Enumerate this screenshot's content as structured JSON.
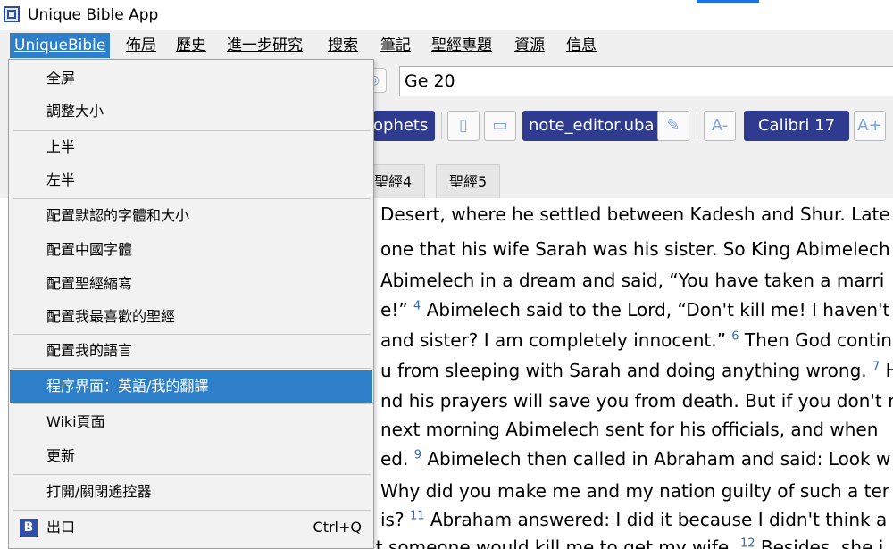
{
  "window": {
    "title": "Unique Bible App"
  },
  "menubar": {
    "items": [
      "UniqueBible",
      "佈局",
      "歷史",
      "進一步研究",
      "搜索",
      "筆記",
      "聖經專題",
      "資源",
      "信息"
    ]
  },
  "toolbar": {
    "reference": "Ge 20",
    "prophets_label": "ophets",
    "note_editor_label": "note_editor.uba",
    "font_label": "Calibri 17"
  },
  "tabs": [
    "聖經4",
    "聖經5"
  ],
  "dropdown": {
    "items": [
      "全屏",
      "調整大小",
      "上半",
      "左半",
      "配置默認的字體和大小",
      "配置中國字體",
      "配置聖經縮寫",
      "配置我最喜歡的聖經",
      "配置我的語言",
      "程序界面：英語/我的翻譯",
      "Wiki頁面",
      "更新",
      "打開/關閉遙控器",
      "出口"
    ],
    "exit_shortcut": "Ctrl+Q"
  },
  "content": {
    "lines": [
      {
        "num": "",
        "text": "Desert, where he settled between Kadesh and Shur. Late"
      },
      {
        "num": "",
        "text": "one that his wife Sarah was his sister. So King Abimelech o"
      },
      {
        "num": "",
        "text": "Abimelech in a dream and said, “You have taken a marri"
      },
      {
        "pre": "e!”",
        "num": "4",
        "text": " Abimelech said to the Lord, “Don't kill me! I haven't"
      },
      {
        "pre": "and sister? I am completely innocent.”",
        "num": "6",
        "text": " Then God contin"
      },
      {
        "pre": "u from sleeping with Sarah and doing anything wrong.",
        "num": "7",
        "text": " H"
      },
      {
        "num": "",
        "text": "nd his prayers will save you from death. But if you don't r"
      },
      {
        "num": "",
        "text": "next morning Abimelech sent for his officials, and when"
      },
      {
        "pre": "ed.",
        "num": "9",
        "text": " Abimelech then called in Abraham and said: Look w"
      },
      {
        "num": "",
        "text": "Why did you make me and my nation guilty of such a ter"
      },
      {
        "pre": "is?",
        "num": "11",
        "text": " Abraham answered: I did it because I didn't think a"
      },
      {
        "pre": "respected God, and I was sure that someone would kill me to get my wife.",
        "num": "12",
        "text": " Besides, she i"
      }
    ]
  }
}
